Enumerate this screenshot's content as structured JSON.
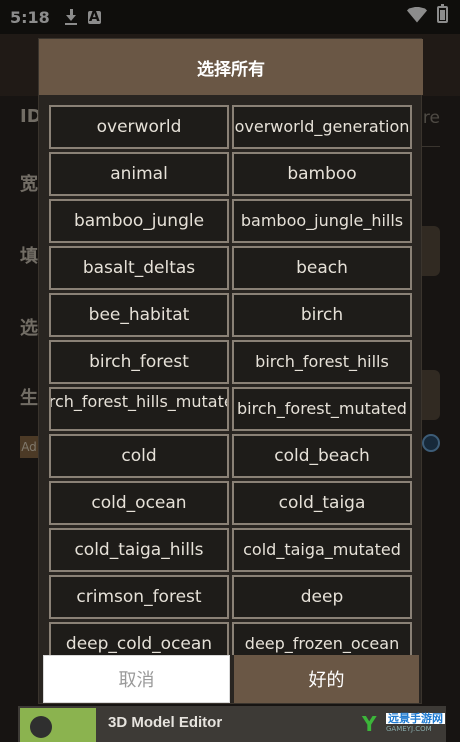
{
  "status_bar": {
    "time": "5:18",
    "icons": [
      "download-icon",
      "a-notification-icon",
      "wifi-icon",
      "battery-icon"
    ],
    "a_icon_letter": "A"
  },
  "background": {
    "labels": [
      "ID",
      "宽",
      "填",
      "选",
      "生"
    ],
    "ghost_text": "re",
    "ad_badge": "Ad"
  },
  "dialog": {
    "title": "选择所有",
    "items": [
      "overworld",
      "overworld_generation",
      "animal",
      "bamboo",
      "bamboo_jungle",
      "bamboo_jungle_hills",
      "basalt_deltas",
      "beach",
      "bee_habitat",
      "birch",
      "birch_forest",
      "birch_forest_hills",
      "birch_forest_hills_mutated",
      "birch_forest_mutated",
      "cold",
      "cold_beach",
      "cold_ocean",
      "cold_taiga",
      "cold_taiga_hills",
      "cold_taiga_mutated",
      "crimson_forest",
      "deep",
      "deep_cold_ocean",
      "deep_frozen_ocean"
    ],
    "cancel_label": "取消",
    "ok_label": "好的"
  },
  "ad_bar": {
    "title": "3D Model Editor"
  },
  "watermark": {
    "main": "远景手游网",
    "sub": "GAMEYJ.COM"
  },
  "colors": {
    "dialog_accent": "#6a5745",
    "cell_border": "#8a8176",
    "cell_bg": "#1e1c19"
  }
}
